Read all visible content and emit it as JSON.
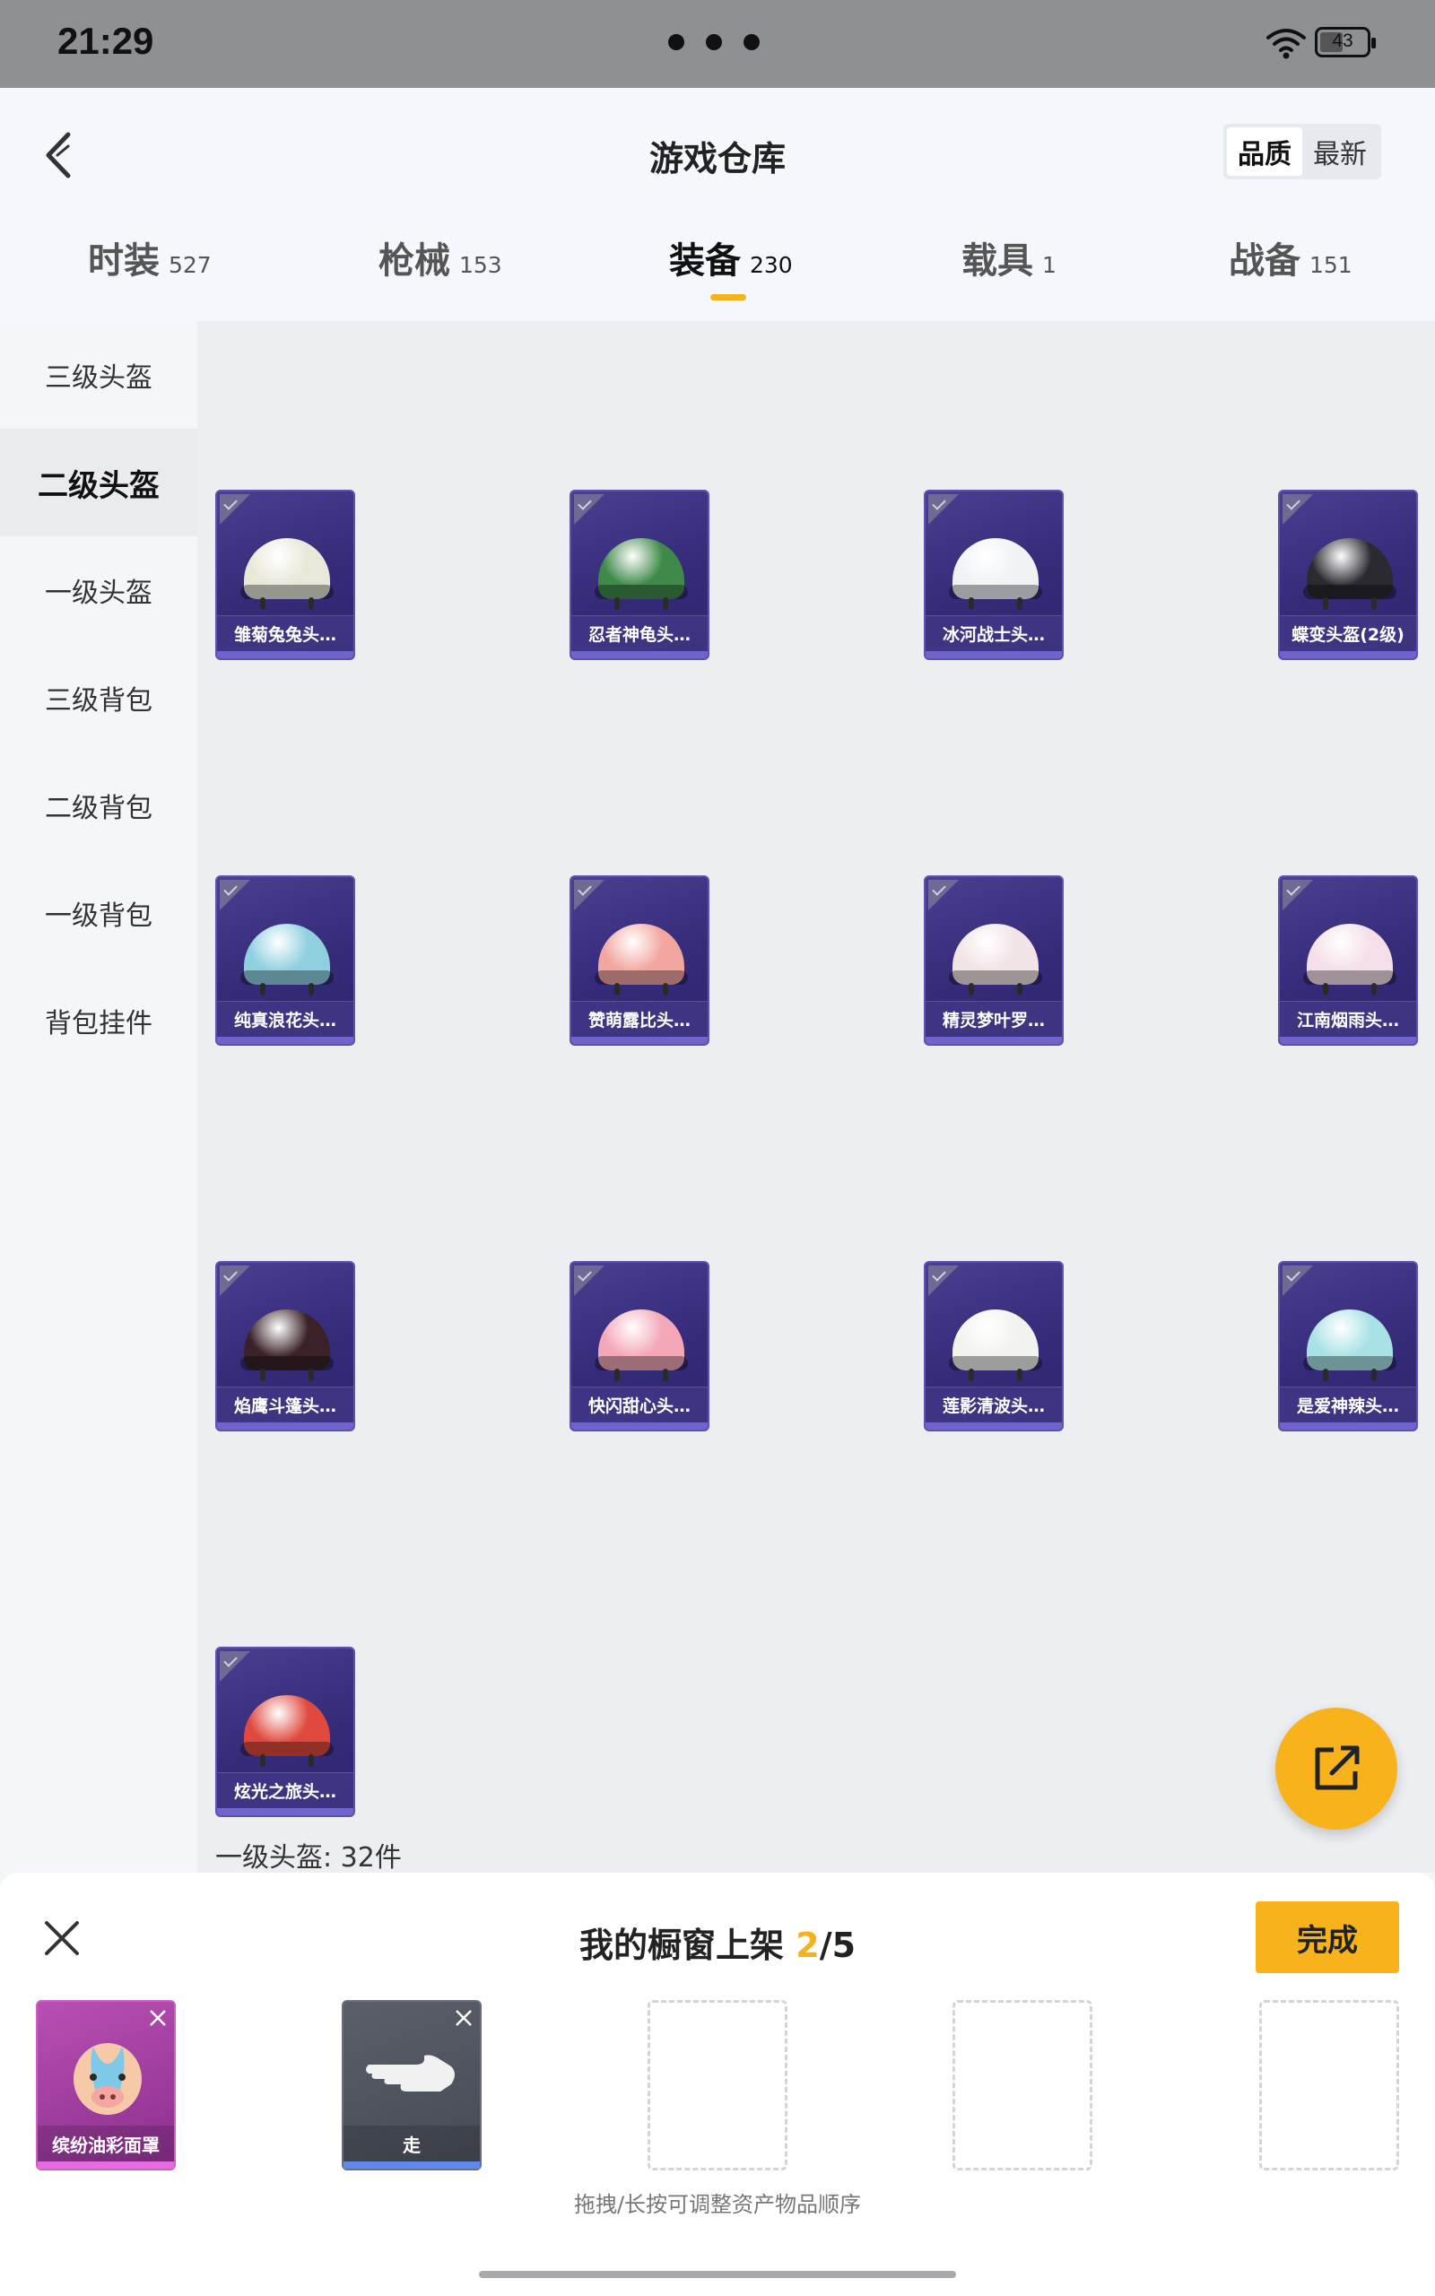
{
  "status_bar": {
    "time": "21:29",
    "battery": "43"
  },
  "header": {
    "title": "游戏仓库",
    "sort_options": [
      "品质",
      "最新"
    ],
    "sort_active": "品质"
  },
  "tabs": [
    {
      "label": "时装",
      "count": "527"
    },
    {
      "label": "枪械",
      "count": "153"
    },
    {
      "label": "装备",
      "count": "230",
      "active": true
    },
    {
      "label": "载具",
      "count": "1"
    },
    {
      "label": "战备",
      "count": "151"
    }
  ],
  "sidebar": {
    "items": [
      "三级头盔",
      "二级头盔",
      "一级头盔",
      "三级背包",
      "二级背包",
      "一级背包",
      "背包挂件"
    ],
    "active": "二级头盔"
  },
  "items": [
    {
      "name": "雏菊兔兔头…",
      "color": "#e9e7d8"
    },
    {
      "name": "忍者神龟头…",
      "color": "#3f8a4a"
    },
    {
      "name": "冰河战士头…",
      "color": "#f0f2f6"
    },
    {
      "name": "蝶变头盔(2级)",
      "color": "#2a2a30"
    },
    {
      "name": "纯真浪花头…",
      "color": "#8fd0e0"
    },
    {
      "name": "赞萌露比头…",
      "color": "#f2a6a0"
    },
    {
      "name": "精灵梦叶罗…",
      "color": "#f1e3e6"
    },
    {
      "name": "江南烟雨头…",
      "color": "#f4dfe8"
    },
    {
      "name": "焰鹰斗篷头…",
      "color": "#3a2228"
    },
    {
      "name": "快闪甜心头…",
      "color": "#f3a7b7"
    },
    {
      "name": "莲影清波头…",
      "color": "#f2f2ee"
    },
    {
      "name": "是爱神辣头…",
      "color": "#a8e2e6"
    },
    {
      "name": "炫光之旅头…",
      "color": "#e04a3e"
    }
  ],
  "group_count": "一级头盔: 32件",
  "showcase": {
    "title": "我的橱窗上架",
    "current": "2",
    "total": "/5",
    "done_label": "完成",
    "slots": [
      {
        "name": "缤纷油彩面罩",
        "kind": "pink"
      },
      {
        "name": "走",
        "kind": "gray"
      }
    ],
    "hint": "拖拽/长按可调整资产物品顺序"
  }
}
